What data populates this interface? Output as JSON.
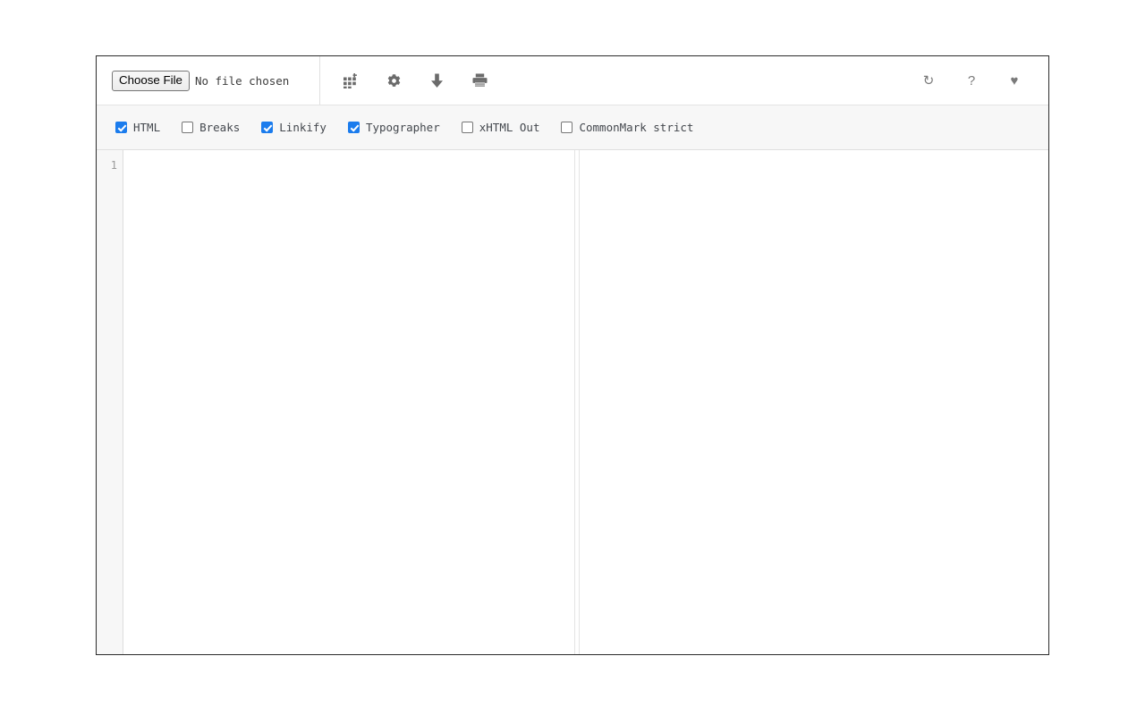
{
  "toolbar": {
    "file_input": {
      "button_label": "Choose File",
      "status_text": "No file chosen"
    },
    "left_icons": [
      {
        "name": "insert-table-icon",
        "title": "Insert table"
      },
      {
        "name": "gear-icon",
        "title": "Settings"
      },
      {
        "name": "download-icon",
        "title": "Download"
      },
      {
        "name": "print-icon",
        "title": "Print"
      }
    ],
    "right_icons": [
      {
        "name": "refresh-icon",
        "title": "Reset",
        "glyph": "↻"
      },
      {
        "name": "help-icon",
        "title": "Help",
        "glyph": "?"
      },
      {
        "name": "heart-icon",
        "title": "Support",
        "glyph": "♥"
      }
    ]
  },
  "options": [
    {
      "label": "HTML",
      "checked": true
    },
    {
      "label": "Breaks",
      "checked": false
    },
    {
      "label": "Linkify",
      "checked": true
    },
    {
      "label": "Typographer",
      "checked": true
    },
    {
      "label": "xHTML Out",
      "checked": false
    },
    {
      "label": "CommonMark strict",
      "checked": false
    }
  ],
  "editor": {
    "line_numbers": [
      "1"
    ],
    "content": ""
  },
  "preview": {
    "content": ""
  },
  "colors": {
    "accent": "#1b7ced",
    "frame_border": "#2b2b2b",
    "bar_background": "#f7f7f7",
    "icon": "#6b6b6b",
    "label_text": "#44484e"
  }
}
